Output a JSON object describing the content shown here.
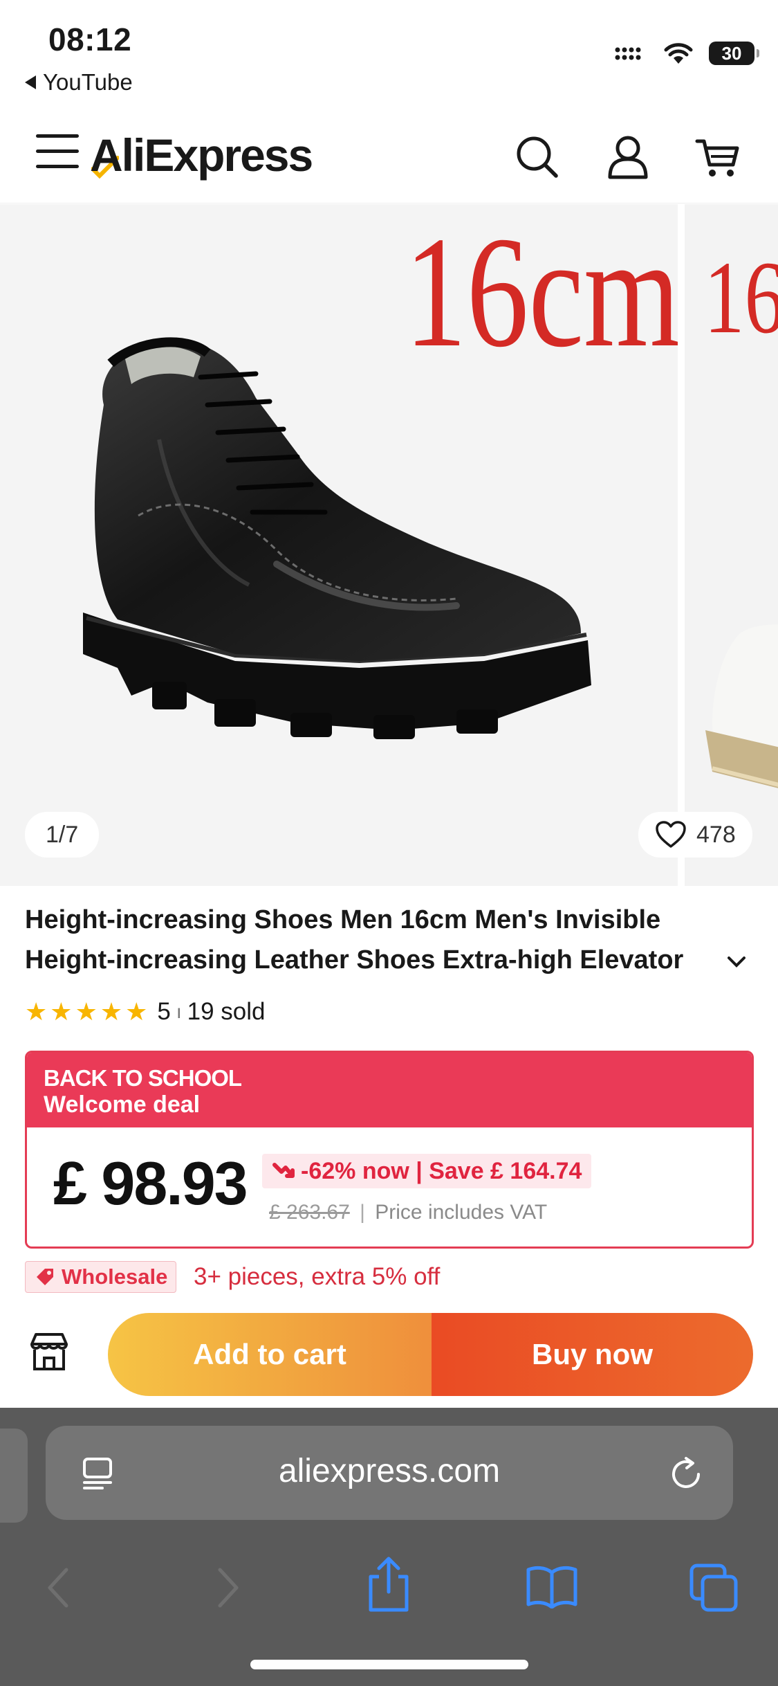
{
  "status_bar": {
    "time": "08:12",
    "back_app": "YouTube",
    "battery": "30"
  },
  "header": {
    "logo": "AliExpress",
    "icons": [
      "menu-icon",
      "search-icon",
      "account-icon",
      "cart-icon"
    ]
  },
  "gallery": {
    "size_label": "16cm",
    "next_size_label": "16",
    "counter": "1/7",
    "wishlist_count": "478"
  },
  "product": {
    "title_line1": "Height-increasing Shoes Men 16cm Men's Invisible",
    "title_line2": "Height-increasing Leather Shoes Extra-high Elevator",
    "rating": "5",
    "sold": "19 sold",
    "stars": 5
  },
  "deal": {
    "banner_line1": "BACK TO SCHOOL",
    "banner_line2": "Welcome deal",
    "price": "£ 98.93",
    "discount": "-62% now | Save  £ 164.74",
    "original_price": "£ 263.67",
    "vat_note": "Price includes VAT",
    "colors": {
      "banner": "#ea3a57",
      "discount_text": "#e0243f"
    }
  },
  "wholesale": {
    "badge": "Wholesale",
    "text": "3+ pieces, extra 5% off"
  },
  "actions": {
    "add_to_cart": "Add to cart",
    "buy_now": "Buy now"
  },
  "browser": {
    "url": "aliexpress.com"
  }
}
